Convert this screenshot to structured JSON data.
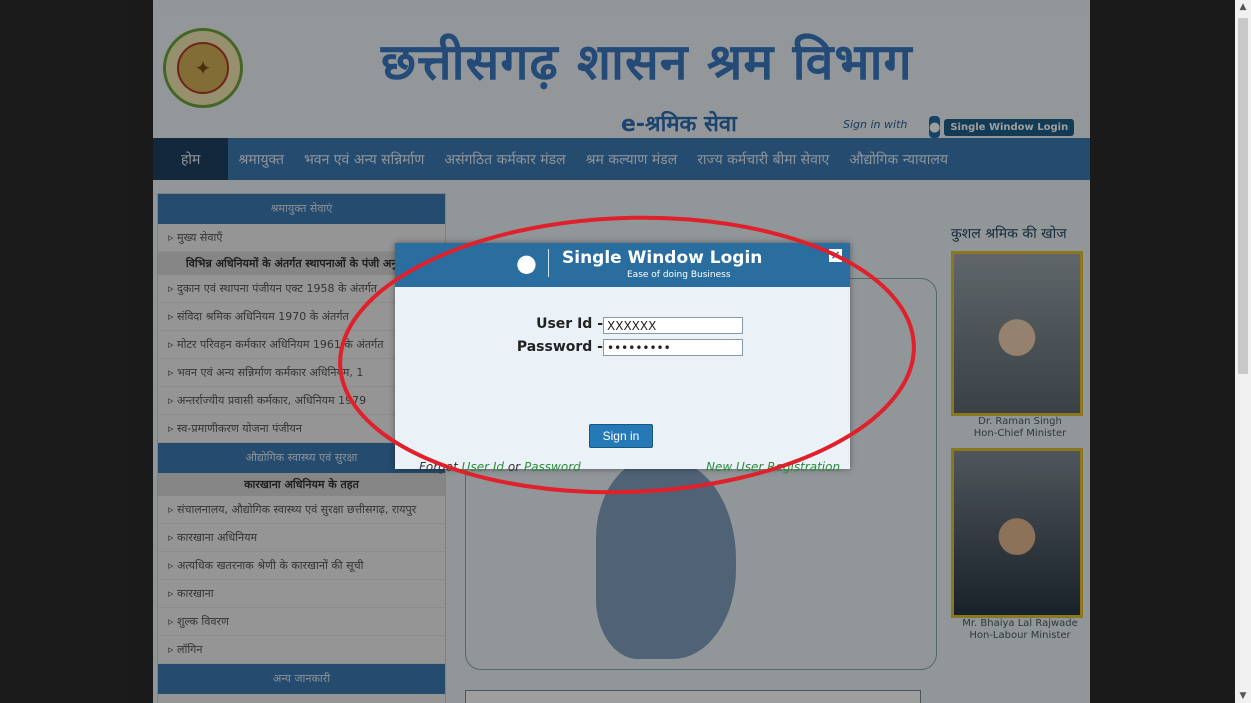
{
  "header": {
    "title": "छत्तीसगढ़ शासन श्रम विभाग",
    "subtitle": "e-श्रमिक सेवा",
    "signin_with": "Sign in with",
    "single_window_label": "Single Window Login"
  },
  "nav": {
    "items": [
      {
        "label": "होम"
      },
      {
        "label": "श्रमायुक्त"
      },
      {
        "label": "भवन एवं अन्य सन्निर्माण"
      },
      {
        "label": "असंगठित कर्मकार मंडल"
      },
      {
        "label": "श्रम कल्याण मंडल"
      },
      {
        "label": "राज्य कर्मचारी बीमा सेवाए"
      },
      {
        "label": "औद्योगिक न्यायालय"
      }
    ]
  },
  "sidebar": {
    "heading1": "श्रमायुक्त सेवाएं",
    "item_main": "मुख्य सेवाएँ",
    "subhead1": "विभिन्न अधिनियमों के अंतर्गत स्थापनाओं के पंजी अनुज्ञप्ति",
    "items1": [
      {
        "label": "दुकान एवं स्थापना पंजीयन एक्ट 1958 के अंतर्गत"
      },
      {
        "label": "संविदा श्रमिक अधिनियम 1970 के अंतर्गत"
      },
      {
        "label": "मोटर परिवहन कर्मकार अधिनियम 1961 के अंतर्गत"
      },
      {
        "label": "भवन एवं अन्य सन्निर्माण कर्मकार अधिनियम, 1"
      },
      {
        "label": "अन्तर्राज्यीय प्रवासी कर्मकार, अधिनियम 1979"
      },
      {
        "label": "स्व-प्रमाणीकरण योजना पंजीयन"
      }
    ],
    "heading2": "औद्योगिक स्वास्थ्य एवं सुरक्षा",
    "subhead2": "कारखाना अधिनियम के तहत",
    "items2": [
      {
        "label": "संचालनालय, औद्योगिक स्वास्थ्य एवं सुरक्षा छत्तीसगढ़, रायपुर"
      },
      {
        "label": "कारखाना अधिनियम"
      },
      {
        "label": "अत्यधिक खतरनाक श्रेणी के कारखानों की सूची"
      },
      {
        "label": "कारखाना"
      },
      {
        "label": "शुल्क विवरण"
      },
      {
        "label": "लॉगिन"
      }
    ],
    "heading3": "अन्य जानकारी"
  },
  "right": {
    "title": "कुशल श्रमिक की खोज",
    "person1_name": "Dr. Raman Singh",
    "person1_role": "Hon-Chief Minister",
    "person2_name": "Mr. Bhaiya Lal Rajwade",
    "person2_role": "Hon-Labour Minister"
  },
  "modal": {
    "title": "Single Window Login",
    "tagline": "Ease of doing Business",
    "close_symbol": "×",
    "userid_label": "User Id -",
    "userid_value": "XXXXXX",
    "password_label": "Password -",
    "password_value": "xxxxxxxxx",
    "signin_label": "Sign in",
    "forgot_prefix": "Forgot",
    "forgot_userid": "User Id",
    "forgot_or": "or",
    "forgot_password": "Password",
    "register_label": "New User Registration"
  },
  "colors": {
    "accent": "#2a6ea0",
    "annotation": "#e0202a"
  }
}
